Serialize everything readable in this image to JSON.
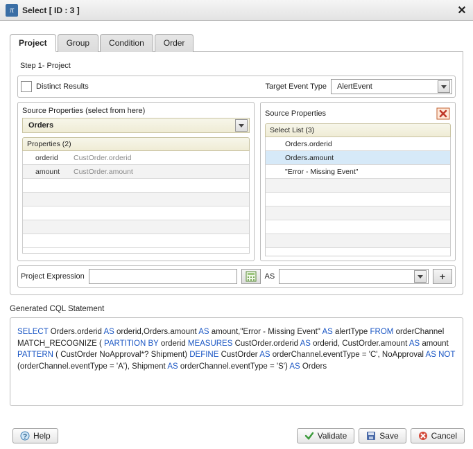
{
  "title": "Select [ ID : 3 ]",
  "tabs": {
    "project": "Project",
    "group": "Group",
    "condition": "Condition",
    "order": "Order"
  },
  "step": "Step 1- Project",
  "distinct_label": "Distinct Results",
  "target_label": "Target Event Type",
  "target_value": "AlertEvent",
  "left": {
    "header": "Source Properties (select from here)",
    "dropdown": "Orders",
    "panel_header": "Properties (2)",
    "rows": [
      {
        "name": "orderid",
        "desc": "CustOrder.orderid"
      },
      {
        "name": "amount",
        "desc": "CustOrder.amount"
      }
    ]
  },
  "right": {
    "header": "Source Properties",
    "panel_header": "Select List (3)",
    "rows": [
      "Orders.orderid",
      "Orders.amount",
      "\"Error - Missing Event\""
    ]
  },
  "projexp": {
    "label": "Project Expression",
    "as": "AS"
  },
  "generated_label": "Generated CQL Statement",
  "cql": {
    "select": "SELECT",
    "fields": "Orders.orderid",
    "as1": "AS",
    "f1b": "orderid,Orders.amount",
    "as2": "AS",
    "f2b": "amount,\"Error - Missing Event\"",
    "as3": "AS",
    "f3b": "alertType",
    "from": "FROM",
    "src": "orderChannel MATCH_RECOGNIZE (",
    "partby": "PARTITION BY",
    "p2": "orderid",
    "measures": "MEASURES",
    "m2": "CustOrder.orderid",
    "as4": "AS",
    "m3": "orderid, CustOrder.amount",
    "as5": "AS",
    "m4": "amount",
    "pattern": "PATTERN",
    "p3": "( CustOrder NoApproval*? Shipment)",
    "define": "DEFINE",
    "d2": "CustOrder",
    "as6": "AS",
    "d3": "orderChannel.eventType = 'C', NoApproval",
    "as7": "AS NOT",
    "d4": "(orderChannel.eventType = 'A'), Shipment",
    "as8": "AS",
    "d5": "orderChannel.eventType = 'S')",
    "as9": "AS",
    "d6": "Orders"
  },
  "footer": {
    "help": "Help",
    "validate": "Validate",
    "save": "Save",
    "cancel": "Cancel"
  }
}
